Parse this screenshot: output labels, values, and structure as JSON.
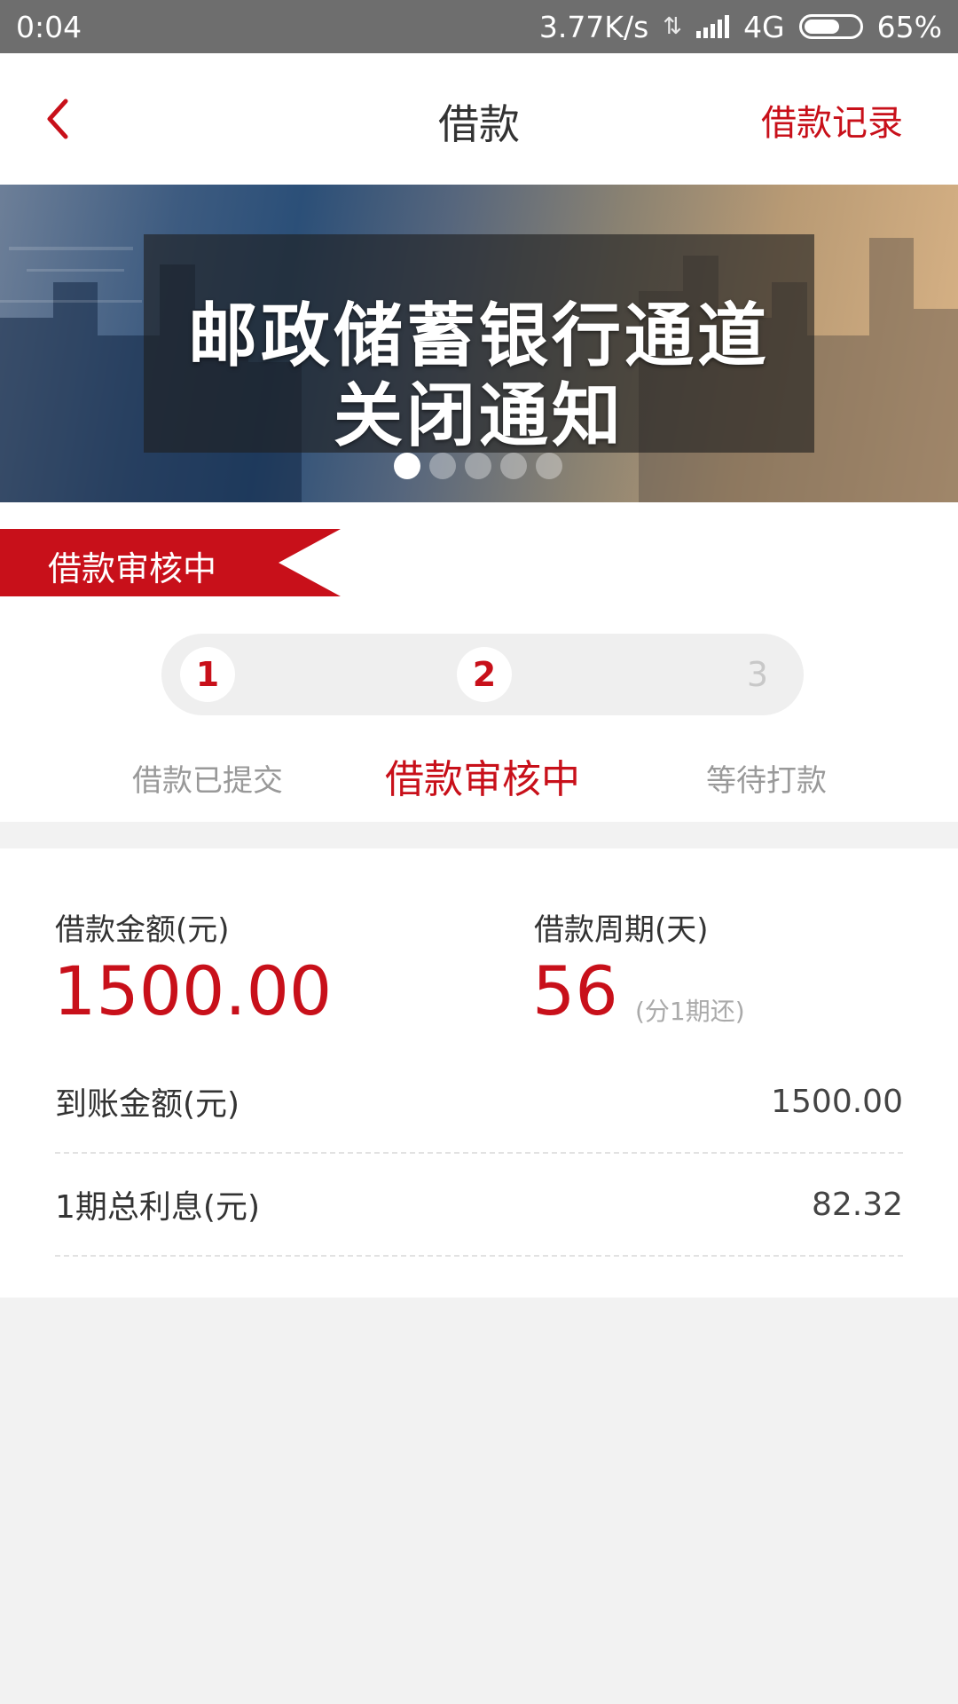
{
  "status_bar": {
    "time": "0:04",
    "net_speed": "3.77K/s",
    "network": "4G",
    "battery": "65%",
    "battery_level": 0.65,
    "icons": [
      "data-arrows-icon",
      "signal-icon",
      "battery-icon"
    ]
  },
  "nav": {
    "back_icon": "chevron-left-icon",
    "title": "借款",
    "record_link": "借款记录"
  },
  "banner": {
    "line1": "邮政储蓄银行通道",
    "line2": "关闭通知",
    "dot_count": 5,
    "active_dot": 0
  },
  "ribbon": {
    "label": "借款审核中"
  },
  "steps": [
    {
      "number": "1",
      "label": "借款已提交",
      "state": "done"
    },
    {
      "number": "2",
      "label": "借款审核中",
      "state": "current"
    },
    {
      "number": "3",
      "label": "等待打款",
      "state": "pending"
    }
  ],
  "loan": {
    "amount_label": "借款金额(元)",
    "amount": "1500.00",
    "period_label": "借款周期(天)",
    "period": "56",
    "period_note": "(分1期还)"
  },
  "rows": [
    {
      "label": "到账金额(元)",
      "value": "1500.00"
    },
    {
      "label": "1期总利息(元)",
      "value": "82.32"
    }
  ],
  "colors": {
    "accent": "#c8101a",
    "status_bar": "#6e6e6e",
    "background": "#f2f2f2"
  }
}
